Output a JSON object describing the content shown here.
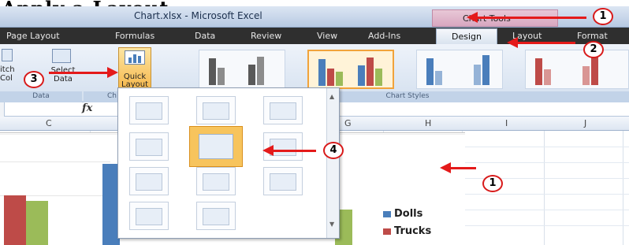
{
  "caption": "Apply a Layout",
  "window": {
    "title": "Chart.xlsx - Microsoft Excel",
    "context_tab": "Chart Tools"
  },
  "tabs": [
    {
      "label": "Page Layout",
      "key": "page-layout"
    },
    {
      "label": "Formulas",
      "key": "formulas"
    },
    {
      "label": "Data",
      "key": "data"
    },
    {
      "label": "Review",
      "key": "review"
    },
    {
      "label": "View",
      "key": "view"
    },
    {
      "label": "Add-Ins",
      "key": "add-ins"
    },
    {
      "label": "Design",
      "key": "design",
      "active": true
    },
    {
      "label": "Layout",
      "key": "layout"
    },
    {
      "label": "Format",
      "key": "format"
    }
  ],
  "ribbon": {
    "switch_label_1": "itch",
    "switch_label_2": "Col",
    "select_label_1": "Select",
    "select_label_2": "Data",
    "quick_label_1": "Quick",
    "quick_label_2": "Layout ▾",
    "group_data": "Data",
    "group_chart_layouts": "Ch",
    "group_chart_styles": "Chart Styles"
  },
  "formula_bar": {
    "fx": "fx"
  },
  "columns": [
    "C",
    "G",
    "H",
    "I",
    "J"
  ],
  "legend": [
    {
      "label": "Dolls",
      "color": "#4a7ebb"
    },
    {
      "label": "Trucks",
      "color": "#be4b48"
    }
  ],
  "callouts": {
    "one": "1",
    "two": "2",
    "three": "3",
    "four": "4"
  },
  "colors": {
    "accent_red": "#e41a1a",
    "quick_layout_highlight": "#f6b84c",
    "bar_blue": "#4a7ebb",
    "bar_red": "#be4b48",
    "bar_green": "#9bbb59"
  }
}
